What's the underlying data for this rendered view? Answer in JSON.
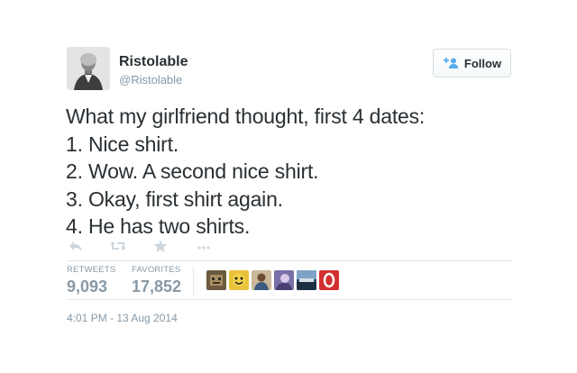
{
  "tweet": {
    "author": {
      "name": "Ristolable",
      "handle": "@Ristolable",
      "avatar_icon": "author-portrait-avatar"
    },
    "follow_button": {
      "label": "Follow",
      "icon": "add-user-icon",
      "accent_color": "#55acee"
    },
    "text_lines": [
      "What my girlfriend thought, first 4 dates:",
      "1. Nice shirt.",
      "2. Wow. A second nice shirt.",
      "3. Okay, first shirt again.",
      "4. He has two shirts."
    ],
    "actions": [
      "reply-icon",
      "retweet-icon",
      "favorite-star-icon",
      "more-ellipsis-icon"
    ],
    "stats": {
      "retweets_label": "RETWEETS",
      "retweets_value": "9,093",
      "favorites_label": "FAVORITES",
      "favorites_value": "17,852"
    },
    "favoriter_avatars": [
      "favoriter-avatar-1",
      "favoriter-avatar-2",
      "favoriter-avatar-3",
      "favoriter-avatar-4",
      "favoriter-avatar-5",
      "favoriter-avatar-6"
    ],
    "timestamp": "4:01 PM - 13 Aug 2014"
  },
  "colors": {
    "text": "#292f33",
    "muted": "#8899a6",
    "divider": "#e1e8ed",
    "follow_icon": "#55acee"
  }
}
